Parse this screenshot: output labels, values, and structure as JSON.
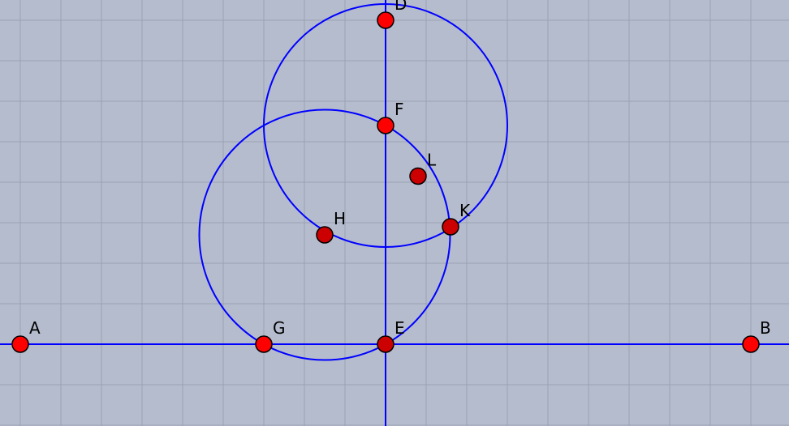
{
  "colors": {
    "background": "#b5bccd",
    "grid": "#9aa2b3",
    "line": "#0000ff",
    "point_fill_free": "#ff0000",
    "point_fill_dependent": "#cc0000",
    "point_stroke": "#000000"
  },
  "points": {
    "A": {
      "label": "A",
      "x": -9,
      "y": 0,
      "kind": "free"
    },
    "B": {
      "label": "B",
      "x": 9,
      "y": 0,
      "kind": "free"
    },
    "D": {
      "label": "D",
      "x": 0,
      "y": 8,
      "kind": "free"
    },
    "E": {
      "label": "E",
      "x": 0,
      "y": 0,
      "kind": "dependent"
    },
    "F": {
      "label": "F",
      "x": 0,
      "y": 5.4,
      "kind": "free"
    },
    "G": {
      "label": "G",
      "x": -3,
      "y": 0,
      "kind": "free"
    },
    "H": {
      "label": "H",
      "x": -1.5,
      "y": 2.7,
      "kind": "dependent"
    },
    "K": {
      "label": "K",
      "x": 1.6,
      "y": 2.9,
      "kind": "dependent"
    },
    "L": {
      "label": "L",
      "x": 0.8,
      "y": 4.15,
      "kind": "dependent"
    }
  },
  "lines": [
    {
      "name": "line-ab",
      "through": [
        "A",
        "B"
      ]
    },
    {
      "name": "line-ed",
      "through": [
        "E",
        "D"
      ]
    }
  ],
  "circles": [
    {
      "name": "circle-center-f",
      "center": [
        "F"
      ],
      "radius": 3.0
    },
    {
      "name": "circle-through-g-e",
      "center": [
        -1.5,
        2.7
      ],
      "radius": 3.09
    }
  ]
}
